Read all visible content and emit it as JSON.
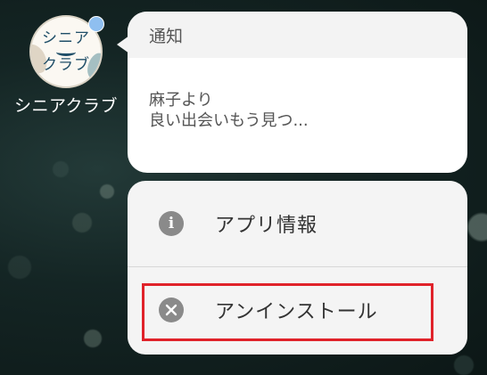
{
  "app": {
    "icon_text_line1": "シニア",
    "icon_text_line2": "クラブ",
    "label": "シニアクラブ",
    "badge_color": "#8fbff0"
  },
  "notification": {
    "header": "通知",
    "line1": "麻子より",
    "line2": "良い出会いもう見つ..."
  },
  "menu": {
    "items": [
      {
        "label": "アプリ情報",
        "icon": "info-icon"
      },
      {
        "label": "アンインストール",
        "icon": "close-circle-icon"
      }
    ]
  },
  "highlight_color": "#e0222a"
}
